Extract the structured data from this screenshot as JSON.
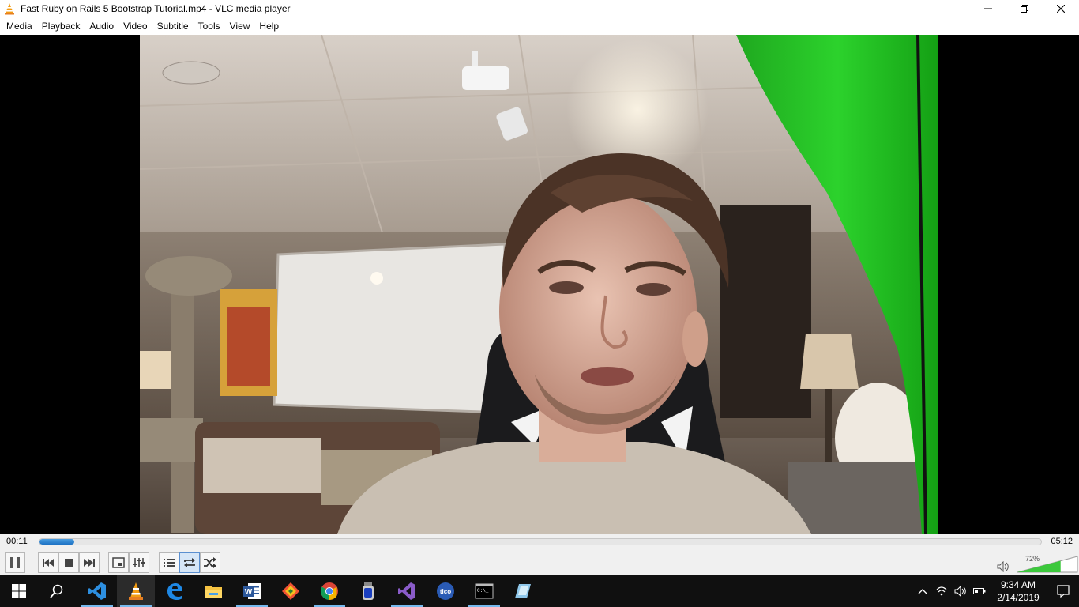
{
  "window": {
    "title": "Fast Ruby on Rails 5 Bootstrap Tutorial.mp4 - VLC media player",
    "app_icon": "vlc-cone-icon",
    "controls": [
      "minimize-icon",
      "maximize-icon",
      "close-icon"
    ]
  },
  "menu": [
    {
      "label": "Media"
    },
    {
      "label": "Playback"
    },
    {
      "label": "Audio"
    },
    {
      "label": "Video"
    },
    {
      "label": "Subtitle"
    },
    {
      "label": "Tools"
    },
    {
      "label": "View"
    },
    {
      "label": "Help"
    }
  ],
  "player": {
    "elapsed": "00:11",
    "total": "05:12",
    "progress_fraction": 0.035,
    "volume_label": "72%",
    "volume_fraction": 0.72,
    "accent_color": "#1d72c4",
    "volume_color": "#3cc83c"
  },
  "controls": [
    {
      "name": "pause-button",
      "icon": "pause-icon"
    },
    {
      "name": "previous-button",
      "icon": "previous-icon"
    },
    {
      "name": "stop-button",
      "icon": "stop-icon"
    },
    {
      "name": "next-button",
      "icon": "next-icon"
    },
    {
      "name": "fullscreen-button",
      "icon": "fullscreen-icon"
    },
    {
      "name": "extended-settings-button",
      "icon": "equalizer-icon"
    },
    {
      "name": "playlist-button",
      "icon": "playlist-icon"
    },
    {
      "name": "loop-button",
      "icon": "loop-icon",
      "active": true
    },
    {
      "name": "shuffle-button",
      "icon": "shuffle-icon"
    }
  ],
  "taskbar": {
    "apps": [
      {
        "name": "vscode",
        "icon": "vscode-icon"
      },
      {
        "name": "vlc",
        "icon": "vlc-cone-icon",
        "active": true
      },
      {
        "name": "edge",
        "icon": "edge-icon"
      },
      {
        "name": "file-explorer",
        "icon": "folder-icon"
      },
      {
        "name": "word",
        "icon": "word-icon"
      },
      {
        "name": "git",
        "icon": "git-icon"
      },
      {
        "name": "chrome",
        "icon": "chrome-icon"
      },
      {
        "name": "tool",
        "icon": "jar-icon"
      },
      {
        "name": "visual-studio",
        "icon": "visual-studio-icon"
      },
      {
        "name": "tico",
        "icon": "tico-icon"
      },
      {
        "name": "terminal",
        "icon": "terminal-icon"
      },
      {
        "name": "notes",
        "icon": "notes-icon"
      }
    ],
    "clock_time": "9:34 AM",
    "clock_date": "2/14/2019"
  }
}
